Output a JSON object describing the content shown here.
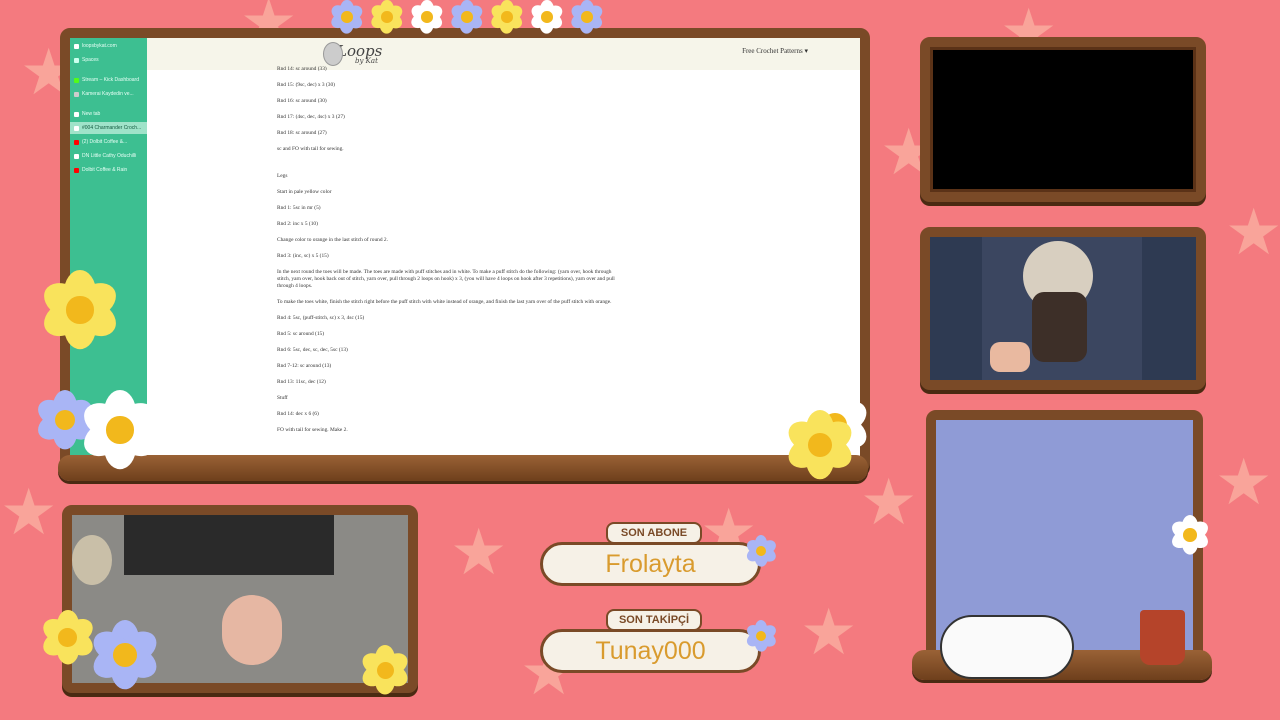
{
  "browser": {
    "sidebar": {
      "items": [
        {
          "label": "loopsbykat.com",
          "icon": "link-icon"
        },
        {
          "label": "Spaces",
          "icon": "folder-icon"
        },
        {
          "label": "Stream – Kick Dashboard",
          "icon": "kick-icon"
        },
        {
          "label": "Kamerai Kaydedin ve...",
          "icon": "camera-icon"
        },
        {
          "label": "New tab",
          "icon": "plus-icon"
        },
        {
          "label": "#004 Charmander Croch...",
          "icon": "page-icon",
          "active": true
        },
        {
          "label": "(2) Dolbit Coffee &...",
          "icon": "youtube-icon"
        },
        {
          "label": "DN Little Cathy Oduchilli",
          "icon": "page-icon"
        },
        {
          "label": "Dolbit Coffee & Rain",
          "icon": "youtube-icon"
        }
      ]
    },
    "site": {
      "logo_text": "Loops",
      "logo_sub": "by Kat",
      "nav_link": "Free Crochet Patterns"
    },
    "pattern_lines": [
      "Rnd 14: sc around (33)",
      "Rnd 15: (9sc, dec) x 3 (30)",
      "Rnd 16: sc around (30)",
      "Rnd 17: (4sc, dec, 4sc) x 3 (27)",
      "Rnd 18: sc around (27)",
      "sc and FO with tail for sewing.",
      "Legs",
      "Start in pale yellow color",
      "Rnd 1: 5sc in mr (5)",
      "Rnd 2: inc x 5 (10)",
      "Change color to orange in the last stitch of round 2.",
      "Rnd 3: (inc, sc) x 5 (15)",
      "In the next round the toes will be made. The toes are made with puff stitches and in white. To make a puff stitch do the following: (yarn over, hook through stitch, yarn over, hook back out of stitch, yarn over, pull through 2 loops on hook) x 3, (you will have 4 loops on hook after 3 repetitions), yarn over and pull through 4 loops.",
      "To make the toes white, finish the stitch right before the puff stitch with white instead of orange, and finish the last yarn over of the puff stitch with orange.",
      "Rnd 4: 5sc, (puff-stitch, sc) x 3, 4sc (15)",
      "Rnd 5: sc around (15)",
      "Rnd 6: 5sc, dec, sc, dec, 5sc (13)",
      "Rnd 7-12: sc around (13)",
      "Rnd 13: 11sc, dec (12)",
      "Stuff",
      "Rnd 14: dec x 6 (6)",
      "FO with tail for sewing. Make 2."
    ]
  },
  "overlay": {
    "son_abone_label": "SON ABONE",
    "son_abone_name": "Frolayta",
    "son_takipci_label": "SON TAKİPÇİ",
    "son_takipci_name": "Tunay000"
  },
  "colors": {
    "background": "#f47a7f",
    "wood": "#7a4a27",
    "sidebar": "#3dbf91",
    "name_text": "#d99b2e"
  }
}
